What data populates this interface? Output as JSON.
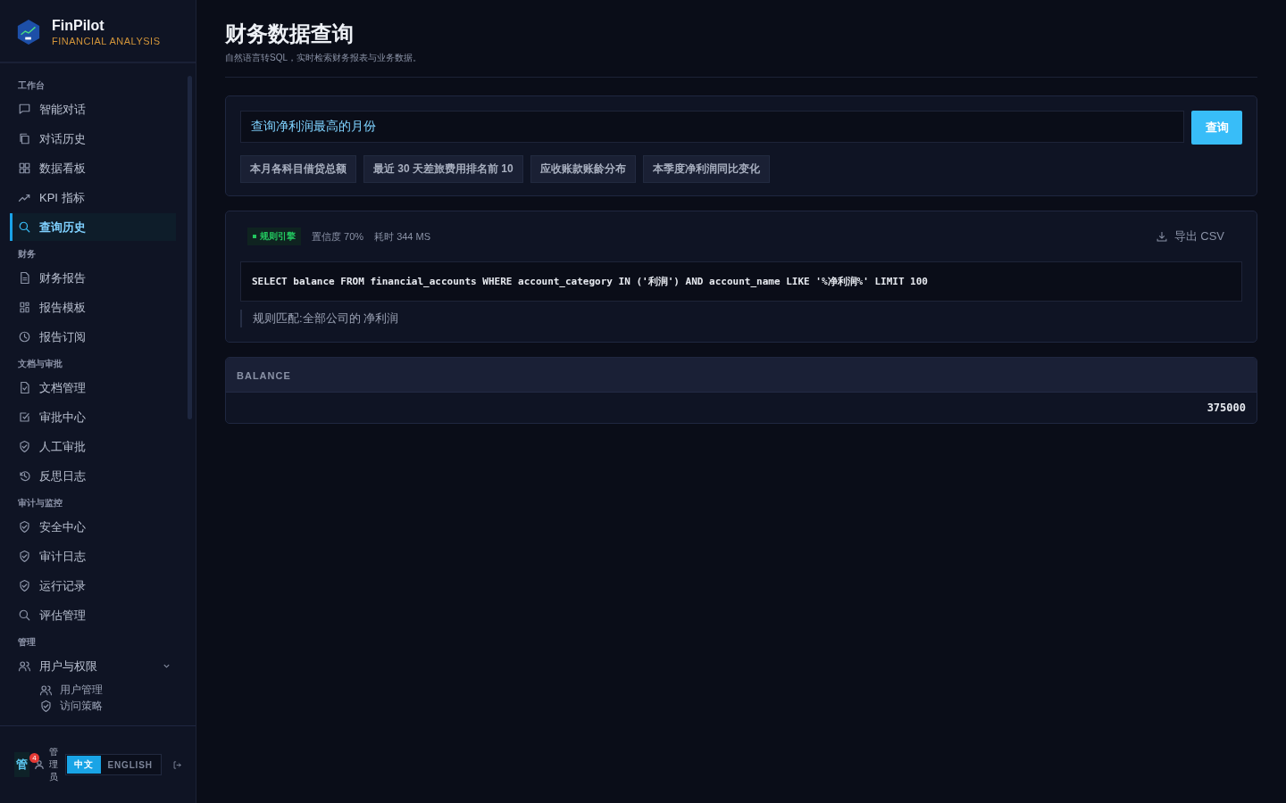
{
  "brand": {
    "name": "FinPilot",
    "tagline": "FINANCIAL ANALYSIS"
  },
  "sidebar": {
    "sections": [
      {
        "title": "工作台",
        "items": [
          {
            "label": "智能对话",
            "selected": false
          },
          {
            "label": "对话历史",
            "selected": false
          },
          {
            "label": "数据看板",
            "selected": false
          },
          {
            "label": "KPI 指标",
            "selected": false
          },
          {
            "label": "查询历史",
            "selected": true
          }
        ]
      },
      {
        "title": "财务",
        "items": [
          {
            "label": "财务报告",
            "selected": false
          },
          {
            "label": "报告模板",
            "selected": false
          },
          {
            "label": "报告订阅",
            "selected": false
          }
        ]
      },
      {
        "title": "文档与审批",
        "items": [
          {
            "label": "文档管理",
            "selected": false
          },
          {
            "label": "审批中心",
            "selected": false
          },
          {
            "label": "人工审批",
            "selected": false
          },
          {
            "label": "反思日志",
            "selected": false
          }
        ]
      },
      {
        "title": "审计与监控",
        "items": [
          {
            "label": "安全中心",
            "selected": false
          },
          {
            "label": "审计日志",
            "selected": false
          },
          {
            "label": "运行记录",
            "selected": false
          },
          {
            "label": "评估管理",
            "selected": false
          }
        ]
      },
      {
        "title": "管理",
        "items": [
          {
            "label": "用户与权限",
            "selected": false,
            "expanded": true,
            "children": [
              {
                "label": "用户管理",
                "selected": false
              },
              {
                "label": "访问策略",
                "selected": false
              }
            ]
          }
        ]
      }
    ]
  },
  "footer": {
    "avatar": "管",
    "notification_count": "4",
    "user_name": "管理员",
    "languages": [
      {
        "label": "中文",
        "selected": true
      },
      {
        "label": "ENGLISH",
        "selected": false
      }
    ]
  },
  "page": {
    "title": "财务数据查询",
    "subtitle": "自然语言转SQL，实时检索财务报表与业务数据。"
  },
  "query": {
    "value": "查询净利润最高的月份",
    "button": "查询",
    "suggestions": [
      "本月各科目借贷总额",
      "最近 30 天差旅费用排名前 10",
      "应收账款账龄分布",
      "本季度净利润同比变化"
    ]
  },
  "result": {
    "engine": "规则引擎",
    "confidence": "置信度 70%",
    "duration": "耗时 344 MS",
    "export": "导出 CSV",
    "sql": "SELECT balance FROM financial_accounts WHERE account_category IN ('利润') AND account_name LIKE '%净利润%' LIMIT 100",
    "explanation": "规则匹配:全部公司的 净利润"
  },
  "table": {
    "columns": [
      "BALANCE"
    ],
    "rows": [
      [
        "375000"
      ]
    ]
  }
}
